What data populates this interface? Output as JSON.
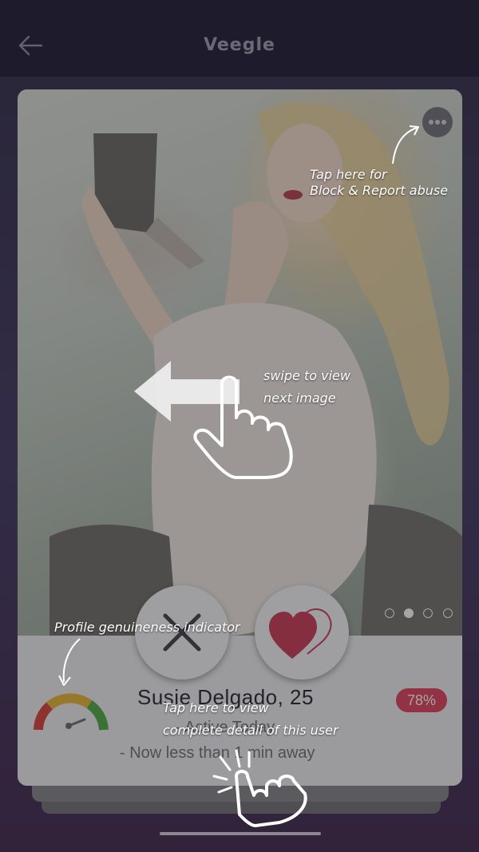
{
  "header": {
    "title": "Veegle",
    "back_icon": "arrow-left-icon"
  },
  "profile": {
    "name_age": "Susie Delgado, 25",
    "active_status": "- Active Today",
    "distance": "- Now less than 1 min away",
    "genuineness_score": "78%",
    "image_count": 4,
    "current_image_index": 2
  },
  "actions": {
    "dislike_icon": "close-x-icon",
    "like_icon": "heart-icon",
    "options_icon": "more-dots-icon"
  },
  "coach_marks": {
    "block_report_line1": "Tap here for",
    "block_report_line2": "Block & Report abuse",
    "swipe_line1": "swipe to view",
    "swipe_line2": "next image",
    "genuineness": "Profile genuineness indicator",
    "detail_line1": "Tap here to view",
    "detail_line2": "complete detail of this user"
  },
  "colors": {
    "header_bg": "#17132b",
    "score_badge": "#e23a57",
    "heart": "#c8324f",
    "gauge_red": "#d63a2f",
    "gauge_yellow": "#e8b32a",
    "gauge_green": "#4aa53a"
  }
}
